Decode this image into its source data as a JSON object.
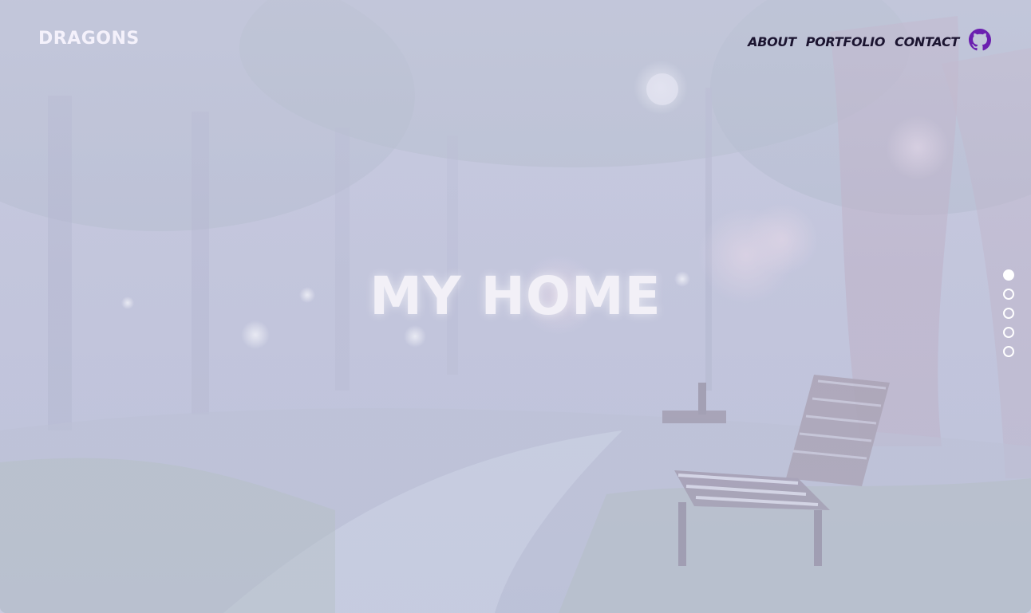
{
  "brand": {
    "logo_text": "DRAGONS"
  },
  "nav": {
    "items": [
      {
        "label": "ABOUT"
      },
      {
        "label": "PORTFOLIO"
      },
      {
        "label": "CONTACT"
      }
    ],
    "github_icon": "github-icon",
    "github_color": "#6b1fb0"
  },
  "hero": {
    "title": "MY HOME"
  },
  "section_dots": {
    "count": 5,
    "active_index": 0
  },
  "colors": {
    "text_dark": "#1b1430",
    "text_light": "#f2f0f7",
    "fog": "#c9cbe0"
  }
}
